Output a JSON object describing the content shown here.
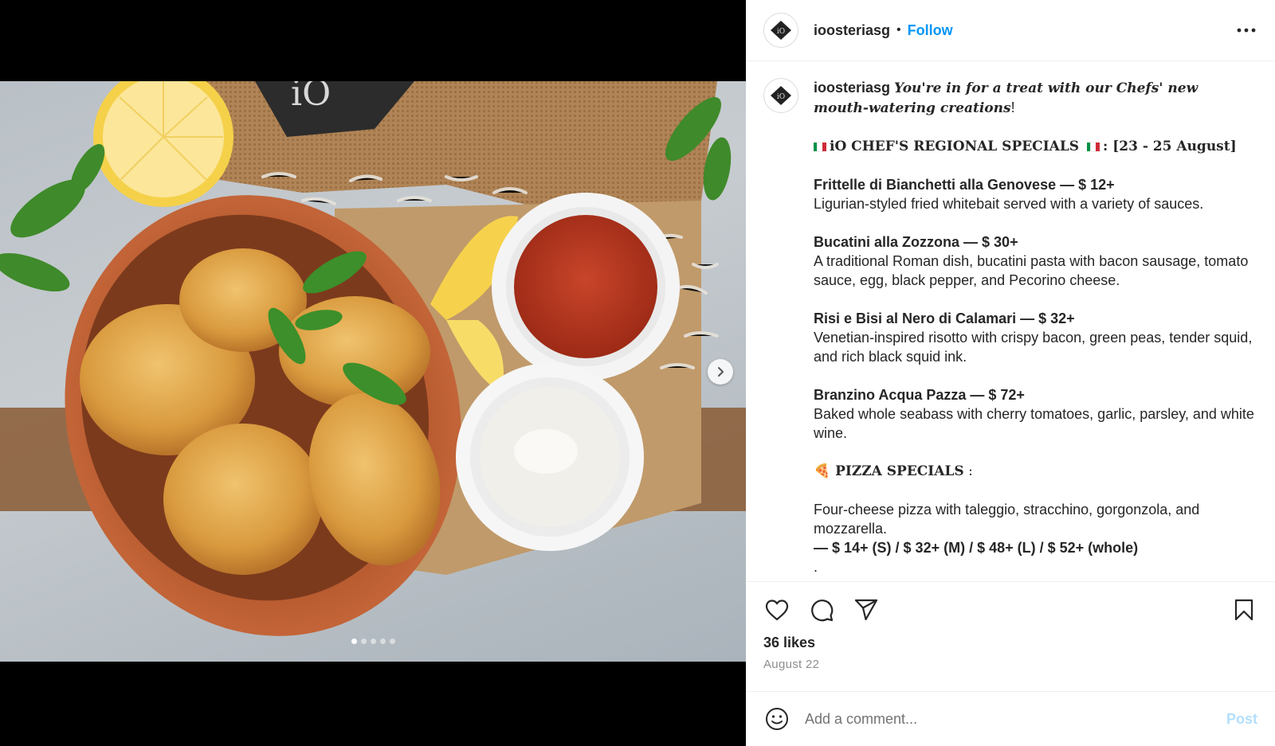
{
  "header": {
    "username": "ioosteriasg",
    "separator": "•",
    "follow_label": "Follow"
  },
  "logo_text": "iO",
  "caption": {
    "username": "ioosteriasg",
    "intro_italic": "You're in for a treat with our Chefs' new mouth-watering creations",
    "intro_end": "!",
    "regional_title": "iO CHEF'S REGIONAL SPECIALS",
    "regional_dates": ": [23 - 25 August]",
    "dishes": [
      {
        "name": "Frittelle di Bianchetti alla Genovese",
        "price": " — $ 12+",
        "desc": "Ligurian-styled fried whitebait served with a variety of sauces."
      },
      {
        "name": "Bucatini alla Zozzona",
        "price": " — $ 30+",
        "desc": "A traditional Roman dish, bucatini pasta with bacon sausage, tomato sauce, egg, black pepper, and Pecorino cheese."
      },
      {
        "name": "Risi e Bisi al Nero di Calamari",
        "price": " — $ 32+",
        "desc": "Venetian-inspired risotto with crispy bacon, green peas, tender squid, and rich black squid ink."
      },
      {
        "name": "Branzino Acqua Pazza",
        "price": " — $ 72+",
        "desc": "Baked whole seabass with cherry tomatoes, garlic, parsley, and white wine."
      }
    ],
    "pizza_emoji": "🍕",
    "pizza_title": "PIZZA SPECIALS",
    "pizza_title_end": " :",
    "pizza_desc": "Four-cheese pizza with taleggio, stracchino, gorgonzola, and mozzarella.",
    "pizza_prices": "— $ 14+ (S) / $ 32+ (M) / $ 48+ (L) / $ 52+ (whole)",
    "trailing": "."
  },
  "actions": {
    "like_icon": "heart-icon",
    "comment_icon": "comment-icon",
    "share_icon": "share-icon",
    "save_icon": "bookmark-icon"
  },
  "likes": "36 likes",
  "date": "August 22",
  "comment": {
    "placeholder": "Add a comment...",
    "post_label": "Post"
  },
  "carousel": {
    "total": 5,
    "active_index": 0
  },
  "colors": {
    "accent": "#0095f6",
    "post_disabled": "#b2dffc",
    "flag_green": "#009246",
    "flag_white": "#ffffff",
    "flag_red": "#ce2b37"
  }
}
